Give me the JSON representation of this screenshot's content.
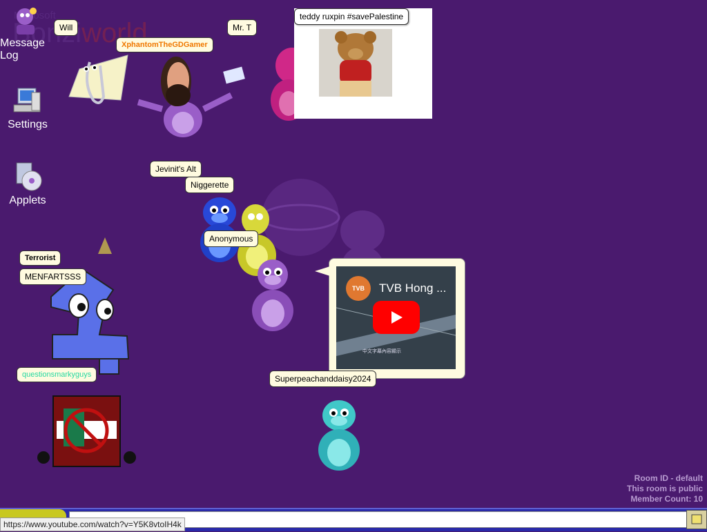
{
  "watermark": {
    "line1": "Microsoft",
    "line2a": "Bonzi",
    "line2b": "world"
  },
  "desktop": [
    {
      "label": "Message Log"
    },
    {
      "label": "Settings"
    },
    {
      "label": "Applets"
    }
  ],
  "users": {
    "will": "Will",
    "mrt": "Mr. T",
    "xphantom": "XphantomTheGDGamer",
    "jevinit": "Jevinit's Alt",
    "niggerette": "Niggerette",
    "anonymous": "Anonymous",
    "terrorist": "Terrorist",
    "menfartsss": "MENFARTSSS",
    "questions": "questionsmarkyguys",
    "superpeach": "Superpeachanddaisy2024"
  },
  "speech": {
    "teddy": "teddy ruxpin #savePalestine"
  },
  "video": {
    "title": "TVB Hong ...",
    "channel_initials": "TVB",
    "caption": "中文字幕內容顯示"
  },
  "room": {
    "line1": "Room ID - default",
    "line2": "This room is public",
    "line3": "Member Count: 10"
  },
  "status_url": "https://www.youtube.com/watch?v=Y5K8vtoIH4k",
  "colors": {
    "bg": "#4a1a6e",
    "bonzi_purple": "#9a5ec8",
    "taskbar": "#2a2aa8"
  }
}
